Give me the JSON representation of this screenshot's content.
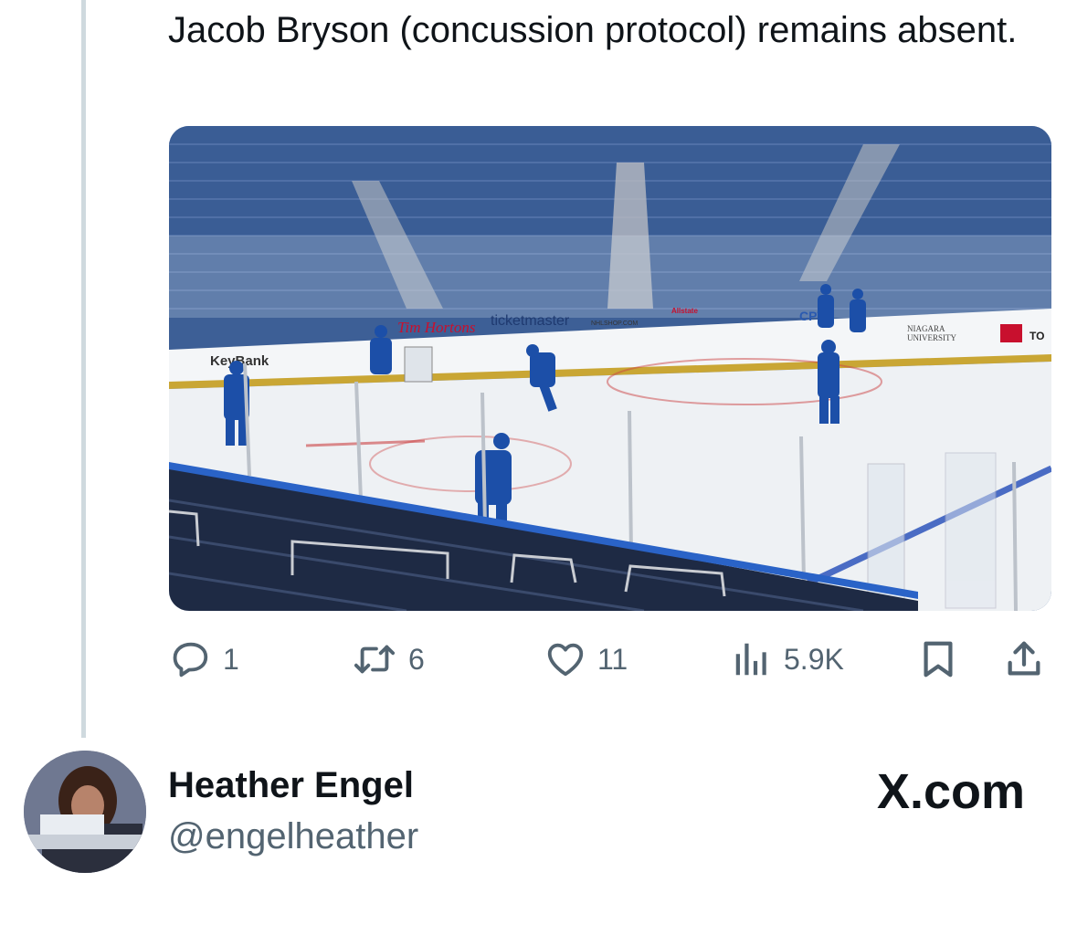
{
  "tweet": {
    "text": "Jacob Bryson (concussion protocol) remains absent."
  },
  "media": {
    "description_alt": "",
    "boards": {
      "keybank": "KeyBank",
      "tims": "Tim Hortons",
      "ticketmaster": "ticketmaster",
      "nhlshop": "NHLSHOP.COM",
      "allstate": "Allstate",
      "cpt": "CPT",
      "niagara_1": "NIAGARA",
      "niagara_2": "UNIVERSITY",
      "toyota": "TO"
    }
  },
  "actions": {
    "reply": {
      "icon": "reply-icon",
      "count": "1"
    },
    "repost": {
      "icon": "repost-icon",
      "count": "6"
    },
    "like": {
      "icon": "heart-icon",
      "count": "11"
    },
    "views": {
      "icon": "views-bars-icon",
      "count": "5.9K"
    },
    "bookmark": {
      "icon": "bookmark-icon"
    },
    "share": {
      "icon": "share-icon"
    }
  },
  "author": {
    "name": "Heather Engel",
    "handle": "@engelheather"
  },
  "brand": {
    "label": "X.com"
  },
  "colors": {
    "text": "#0f1419",
    "secondary": "#536471",
    "thread_line": "#cfd9de",
    "team_blue": "#1c4fa8"
  }
}
